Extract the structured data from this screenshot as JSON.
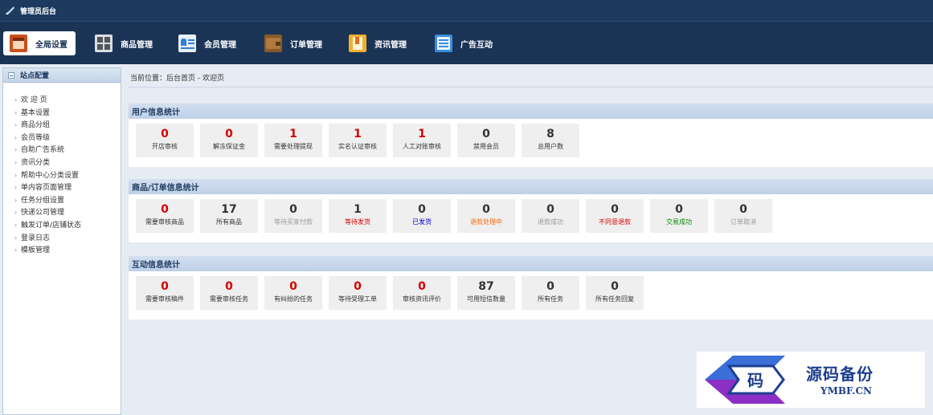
{
  "topbar": {
    "title": "管理员后台"
  },
  "nav": [
    {
      "label": "全局设置",
      "icon": "settings-panel-icon",
      "active": true
    },
    {
      "label": "商品管理",
      "icon": "grid-icon"
    },
    {
      "label": "会员管理",
      "icon": "member-card-icon"
    },
    {
      "label": "订单管理",
      "icon": "wallet-icon"
    },
    {
      "label": "资讯管理",
      "icon": "bookmark-icon"
    },
    {
      "label": "广告互动",
      "icon": "list-icon"
    }
  ],
  "sidebar": {
    "header": "站点配置",
    "items": [
      {
        "label": "欢 迎 页"
      },
      {
        "label": "基本设置"
      },
      {
        "label": "商品分组"
      },
      {
        "label": "会员等级"
      },
      {
        "label": "自助广告系统"
      },
      {
        "label": "资讯分类"
      },
      {
        "label": "帮助中心分类设置"
      },
      {
        "label": "单内容页面管理"
      },
      {
        "label": "任务分组设置"
      },
      {
        "label": "快递公司管理"
      },
      {
        "label": "触发订单/店铺状态"
      },
      {
        "label": "登录日志"
      },
      {
        "label": "模板管理"
      }
    ]
  },
  "breadcrumb": "当前位置：后台首页 - 欢迎页",
  "sections": [
    {
      "title": "用户信息统计",
      "cards": [
        {
          "value": "0",
          "label": "开店审核",
          "value_color": "#d40000",
          "label_color": "#333333"
        },
        {
          "value": "0",
          "label": "解冻保证金",
          "value_color": "#d40000",
          "label_color": "#333333"
        },
        {
          "value": "1",
          "label": "需要处理提现",
          "value_color": "#d40000",
          "label_color": "#333333"
        },
        {
          "value": "1",
          "label": "实名认证审核",
          "value_color": "#d40000",
          "label_color": "#333333"
        },
        {
          "value": "1",
          "label": "人工对账审核",
          "value_color": "#d40000",
          "label_color": "#333333"
        },
        {
          "value": "0",
          "label": "禁用会员",
          "value_color": "#333333",
          "label_color": "#333333"
        },
        {
          "value": "8",
          "label": "总用户数",
          "value_color": "#333333",
          "label_color": "#333333"
        }
      ]
    },
    {
      "title": "商品/订单信息统计",
      "cards": [
        {
          "value": "0",
          "label": "需要审核商品",
          "value_color": "#d40000",
          "label_color": "#333333"
        },
        {
          "value": "17",
          "label": "所有商品",
          "value_color": "#333333",
          "label_color": "#333333"
        },
        {
          "value": "0",
          "label": "等待买家付款",
          "value_color": "#333333",
          "label_color": "#999999"
        },
        {
          "value": "1",
          "label": "等待发货",
          "value_color": "#333333",
          "label_color": "#d40000"
        },
        {
          "value": "0",
          "label": "已发货",
          "value_color": "#333333",
          "label_color": "#0000cc"
        },
        {
          "value": "0",
          "label": "退款处理中",
          "value_color": "#333333",
          "label_color": "#ff6600"
        },
        {
          "value": "0",
          "label": "退款成功",
          "value_color": "#333333",
          "label_color": "#999999"
        },
        {
          "value": "0",
          "label": "不同意退款",
          "value_color": "#333333",
          "label_color": "#d40000"
        },
        {
          "value": "0",
          "label": "交易成功",
          "value_color": "#333333",
          "label_color": "#008800"
        },
        {
          "value": "0",
          "label": "订单取消",
          "value_color": "#333333",
          "label_color": "#999999"
        }
      ]
    },
    {
      "title": "互动信息统计",
      "cards": [
        {
          "value": "0",
          "label": "需要审核稿件",
          "value_color": "#d40000",
          "label_color": "#333333"
        },
        {
          "value": "0",
          "label": "需要审核任务",
          "value_color": "#d40000",
          "label_color": "#333333"
        },
        {
          "value": "0",
          "label": "有纠纷的任务",
          "value_color": "#d40000",
          "label_color": "#333333"
        },
        {
          "value": "0",
          "label": "等待受理工单",
          "value_color": "#d40000",
          "label_color": "#333333"
        },
        {
          "value": "0",
          "label": "审核资讯评价",
          "value_color": "#d40000",
          "label_color": "#333333"
        },
        {
          "value": "87",
          "label": "可用短信数量",
          "value_color": "#333333",
          "label_color": "#333333"
        },
        {
          "value": "0",
          "label": "所有任务",
          "value_color": "#333333",
          "label_color": "#333333"
        },
        {
          "value": "0",
          "label": "所有任务回复",
          "value_color": "#333333",
          "label_color": "#333333"
        }
      ]
    }
  ],
  "watermark": {
    "cn": "源码备份",
    "en": "YMBF.CN",
    "badge": "码"
  }
}
